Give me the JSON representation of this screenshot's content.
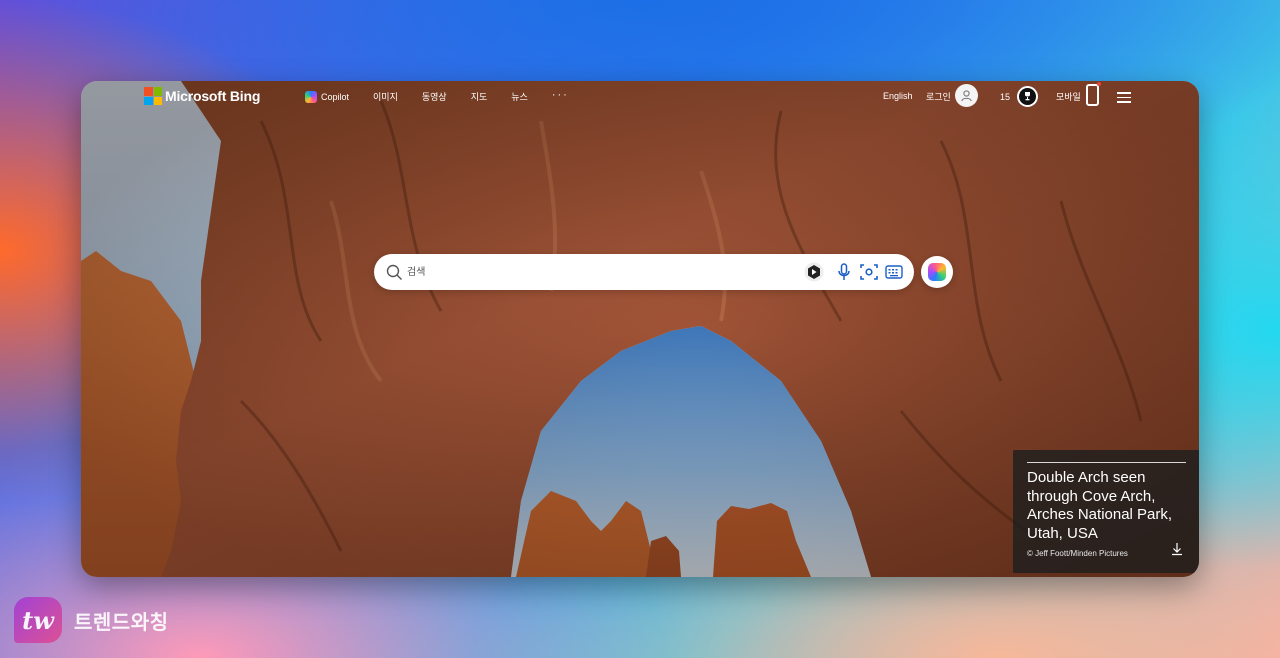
{
  "header": {
    "brand": "Microsoft Bing",
    "nav": [
      {
        "label": "Copilot",
        "icon": "copilot-icon"
      },
      {
        "label": "이미지"
      },
      {
        "label": "동영상"
      },
      {
        "label": "지도"
      },
      {
        "label": "뉴스"
      }
    ],
    "more_label": "···",
    "language": "English",
    "login": "로그인",
    "rewards_points": "15",
    "mobile": "모바일"
  },
  "search": {
    "placeholder": "검색"
  },
  "caption": {
    "title": "Double Arch seen through Cove Arch, Arches National Park, Utah, USA",
    "credit": "© Jeff Foott/Minden Pictures"
  },
  "watermark": {
    "logo_text": "tw",
    "text": "트렌드와칭"
  },
  "colors": {
    "logo_red": "#f25022",
    "logo_green": "#7fba00",
    "logo_blue": "#00a4ef",
    "logo_yellow": "#ffb900"
  }
}
